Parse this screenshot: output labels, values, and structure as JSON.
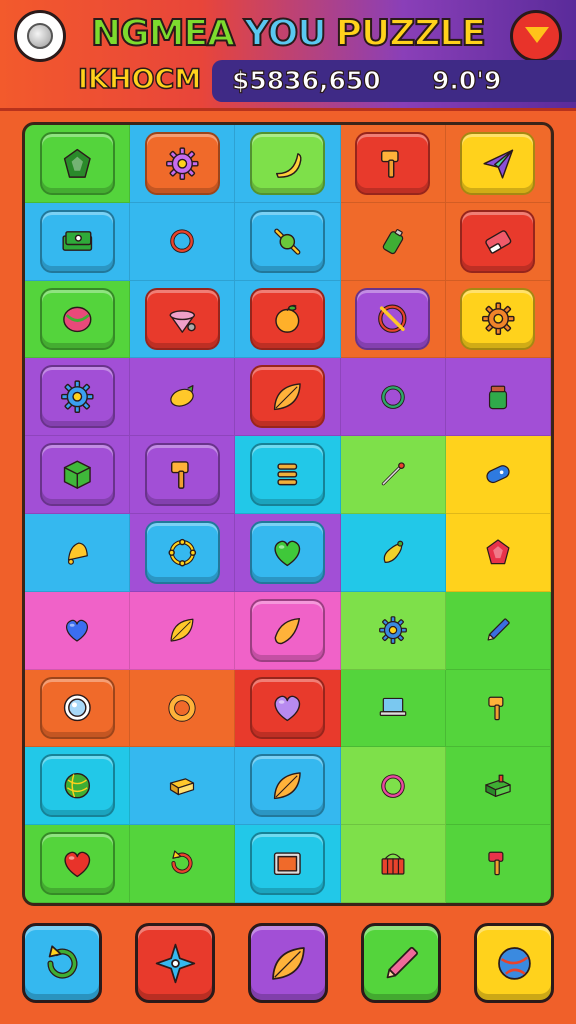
{
  "header": {
    "title_words": [
      "NGMEA",
      "YOU",
      "PUZZLE"
    ],
    "menu_icon": "menu-orb-icon",
    "heart_icon": "heart-shield-icon",
    "left_label": "IKHOCM",
    "score": "$5836,650",
    "moves": "9.0'9"
  },
  "colors": {
    "orange": "#f06a2a",
    "blue": "#35b8ef",
    "green": "#54d43c",
    "red": "#e83a2c",
    "purple": "#a24fd6",
    "yellow": "#ffd21c",
    "cyan": "#22c8e8",
    "pink": "#f062c8",
    "lime": "#7ee04a"
  },
  "board": {
    "rows": [
      [
        {
          "bg": "green",
          "tile": "green",
          "icon": "gem-icon",
          "glyph": "gem",
          "ic": "#2a8a2a"
        },
        {
          "bg": "blue",
          "tile": "orange",
          "icon": "gear-icon",
          "glyph": "gear",
          "ic": "#c66cf0"
        },
        {
          "bg": "blue",
          "tile": "lime",
          "icon": "banana-icon",
          "glyph": "banana",
          "ic": "#ffcf3a"
        },
        {
          "bg": "orange",
          "tile": "red",
          "icon": "hammer-icon",
          "glyph": "hammer",
          "ic": "#ffb23a"
        },
        {
          "bg": "orange",
          "tile": "yellow",
          "icon": "paper-plane-icon",
          "glyph": "plane",
          "ic": "#8a4fd8"
        }
      ],
      [
        {
          "bg": "blue",
          "tile": "blue",
          "icon": "cash-stack-icon",
          "glyph": "cash",
          "ic": "#2faa3a"
        },
        {
          "bg": "blue",
          "tile": "flat",
          "icon": "ring-gear-icon",
          "glyph": "ring",
          "ic": "#e8432c"
        },
        {
          "bg": "blue",
          "tile": "blue",
          "icon": "wrench-icon",
          "glyph": "wrench",
          "ic": "#6ac83a"
        },
        {
          "bg": "orange",
          "tile": "flat",
          "icon": "battery-icon",
          "glyph": "battery",
          "ic": "#3fae34"
        },
        {
          "bg": "orange",
          "tile": "red",
          "icon": "eraser-icon",
          "glyph": "eraser",
          "ic": "#f05a6a"
        }
      ],
      [
        {
          "bg": "green",
          "tile": "green",
          "icon": "melon-icon",
          "glyph": "melon",
          "ic": "#e84a7a"
        },
        {
          "bg": "blue",
          "tile": "red",
          "icon": "spinning-top-icon",
          "glyph": "top",
          "ic": "#f0a0c8"
        },
        {
          "bg": "blue",
          "tile": "red",
          "icon": "apple-icon",
          "glyph": "apple",
          "ic": "#ffb02a"
        },
        {
          "bg": "orange",
          "tile": "purple",
          "icon": "no-tools-icon",
          "glyph": "noentry",
          "ic": "#e8432c"
        },
        {
          "bg": "orange",
          "tile": "yellow",
          "icon": "cog-icon",
          "glyph": "gear",
          "ic": "#f0842a"
        }
      ],
      [
        {
          "bg": "purple",
          "tile": "purple",
          "icon": "gear-icon",
          "glyph": "gear",
          "ic": "#3aa0f0"
        },
        {
          "bg": "purple",
          "tile": "flat",
          "icon": "lemon-icon",
          "glyph": "lemon",
          "ic": "#ffc82a"
        },
        {
          "bg": "purple",
          "tile": "red",
          "icon": "leaf-icon",
          "glyph": "leaf",
          "ic": "#ffb23a"
        },
        {
          "bg": "purple",
          "tile": "flat",
          "icon": "swirl-ring-icon",
          "glyph": "ring",
          "ic": "#2ea86a"
        },
        {
          "bg": "purple",
          "tile": "flat",
          "icon": "jar-icon",
          "glyph": "jar",
          "ic": "#2faa4a"
        }
      ],
      [
        {
          "bg": "purple",
          "tile": "purple",
          "icon": "cube-icon",
          "glyph": "cube",
          "ic": "#3fb83a"
        },
        {
          "bg": "purple",
          "tile": "purple",
          "icon": "hammer-icon",
          "glyph": "hammer",
          "ic": "#ffb23a"
        },
        {
          "bg": "cyan",
          "tile": "cyan",
          "icon": "spring-icon",
          "glyph": "spring",
          "ic": "#f0b03a"
        },
        {
          "bg": "lime",
          "tile": "flat",
          "icon": "dart-icon",
          "glyph": "dart",
          "ic": "#e8432c"
        },
        {
          "bg": "yellow",
          "tile": "flat",
          "icon": "capsule-icon",
          "glyph": "capsule",
          "ic": "#2e7ae0"
        }
      ],
      [
        {
          "bg": "blue",
          "tile": "flat",
          "icon": "bell-icon",
          "glyph": "bell",
          "ic": "#ffc82a"
        },
        {
          "bg": "purple",
          "tile": "blue",
          "icon": "target-ring-icon",
          "glyph": "target",
          "ic": "#ffd21c"
        },
        {
          "bg": "purple",
          "tile": "blue",
          "icon": "heart-icon",
          "glyph": "heart",
          "ic": "#3fc83a"
        },
        {
          "bg": "cyan",
          "tile": "flat",
          "icon": "bulb-icon",
          "glyph": "bulb",
          "ic": "#f0d22a"
        },
        {
          "bg": "yellow",
          "tile": "flat",
          "icon": "gem-icon",
          "glyph": "gem",
          "ic": "#e8334a"
        }
      ],
      [
        {
          "bg": "pink",
          "tile": "flat",
          "icon": "heart-icon",
          "glyph": "heart",
          "ic": "#3a6ef0"
        },
        {
          "bg": "pink",
          "tile": "flat",
          "icon": "leaf-icon",
          "glyph": "leaf",
          "ic": "#ffc82a"
        },
        {
          "bg": "pink",
          "tile": "pink",
          "icon": "cone-icon",
          "glyph": "cone",
          "ic": "#ffb23a"
        },
        {
          "bg": "lime",
          "tile": "flat",
          "icon": "gear-icon",
          "glyph": "gear",
          "ic": "#3a8ae0"
        },
        {
          "bg": "green",
          "tile": "flat",
          "icon": "pencil-icon",
          "glyph": "pencil",
          "ic": "#3a6ee0"
        }
      ],
      [
        {
          "bg": "orange",
          "tile": "orange",
          "icon": "orb-icon",
          "glyph": "orb",
          "ic": "#a8d8f8"
        },
        {
          "bg": "orange",
          "tile": "flat",
          "icon": "donut-icon",
          "glyph": "donut",
          "ic": "#ffb23a"
        },
        {
          "bg": "red",
          "tile": "red",
          "icon": "heart-icon",
          "glyph": "heart",
          "ic": "#b88af0"
        },
        {
          "bg": "green",
          "tile": "flat",
          "icon": "laptop-icon",
          "glyph": "laptop",
          "ic": "#7ac8f0"
        },
        {
          "bg": "green",
          "tile": "flat",
          "icon": "hammer-icon",
          "glyph": "hammer",
          "ic": "#ffb23a"
        }
      ],
      [
        {
          "bg": "cyan",
          "tile": "cyan",
          "icon": "yarn-ball-icon",
          "glyph": "yarn",
          "ic": "#3fae34"
        },
        {
          "bg": "blue",
          "tile": "flat",
          "icon": "book-icon",
          "glyph": "book",
          "ic": "#ffc82a"
        },
        {
          "bg": "blue",
          "tile": "blue",
          "icon": "leaf-icon",
          "glyph": "leaf",
          "ic": "#ffb23a"
        },
        {
          "bg": "lime",
          "tile": "flat",
          "icon": "link-icon",
          "glyph": "ring",
          "ic": "#e84aa0"
        },
        {
          "bg": "green",
          "tile": "flat",
          "icon": "box-icon",
          "glyph": "box",
          "ic": "#3fae34"
        }
      ],
      [
        {
          "bg": "green",
          "tile": "green",
          "icon": "heart-icon",
          "glyph": "heart",
          "ic": "#e8332a"
        },
        {
          "bg": "green",
          "tile": "flat",
          "icon": "refresh-icon",
          "glyph": "refresh",
          "ic": "#e8432c"
        },
        {
          "bg": "cyan",
          "tile": "cyan",
          "icon": "tablet-icon",
          "glyph": "tablet",
          "ic": "#f06a2a"
        },
        {
          "bg": "lime",
          "tile": "flat",
          "icon": "basket-icon",
          "glyph": "basket",
          "ic": "#e8432c"
        },
        {
          "bg": "green",
          "tile": "flat",
          "icon": "megaphone-icon",
          "glyph": "hammer",
          "ic": "#e8334a"
        }
      ]
    ]
  },
  "powerups": [
    {
      "name": "powerup-shuffle",
      "icon": "shuffle-arrows-icon",
      "glyph": "refresh",
      "tile": "blue",
      "ic": "#3fae34"
    },
    {
      "name": "powerup-star",
      "icon": "shuriken-star-icon",
      "glyph": "star",
      "tile": "red",
      "ic": "#35b8ef"
    },
    {
      "name": "powerup-leaf",
      "icon": "leaf-icon",
      "glyph": "leaf",
      "tile": "purple",
      "ic": "#ffb23a"
    },
    {
      "name": "powerup-pencil",
      "icon": "pencil-icon",
      "glyph": "pencil",
      "tile": "green",
      "ic": "#f06a9a"
    },
    {
      "name": "powerup-globe",
      "icon": "globe-icon",
      "glyph": "globe",
      "tile": "yellow",
      "ic": "#3a8ae0"
    }
  ]
}
